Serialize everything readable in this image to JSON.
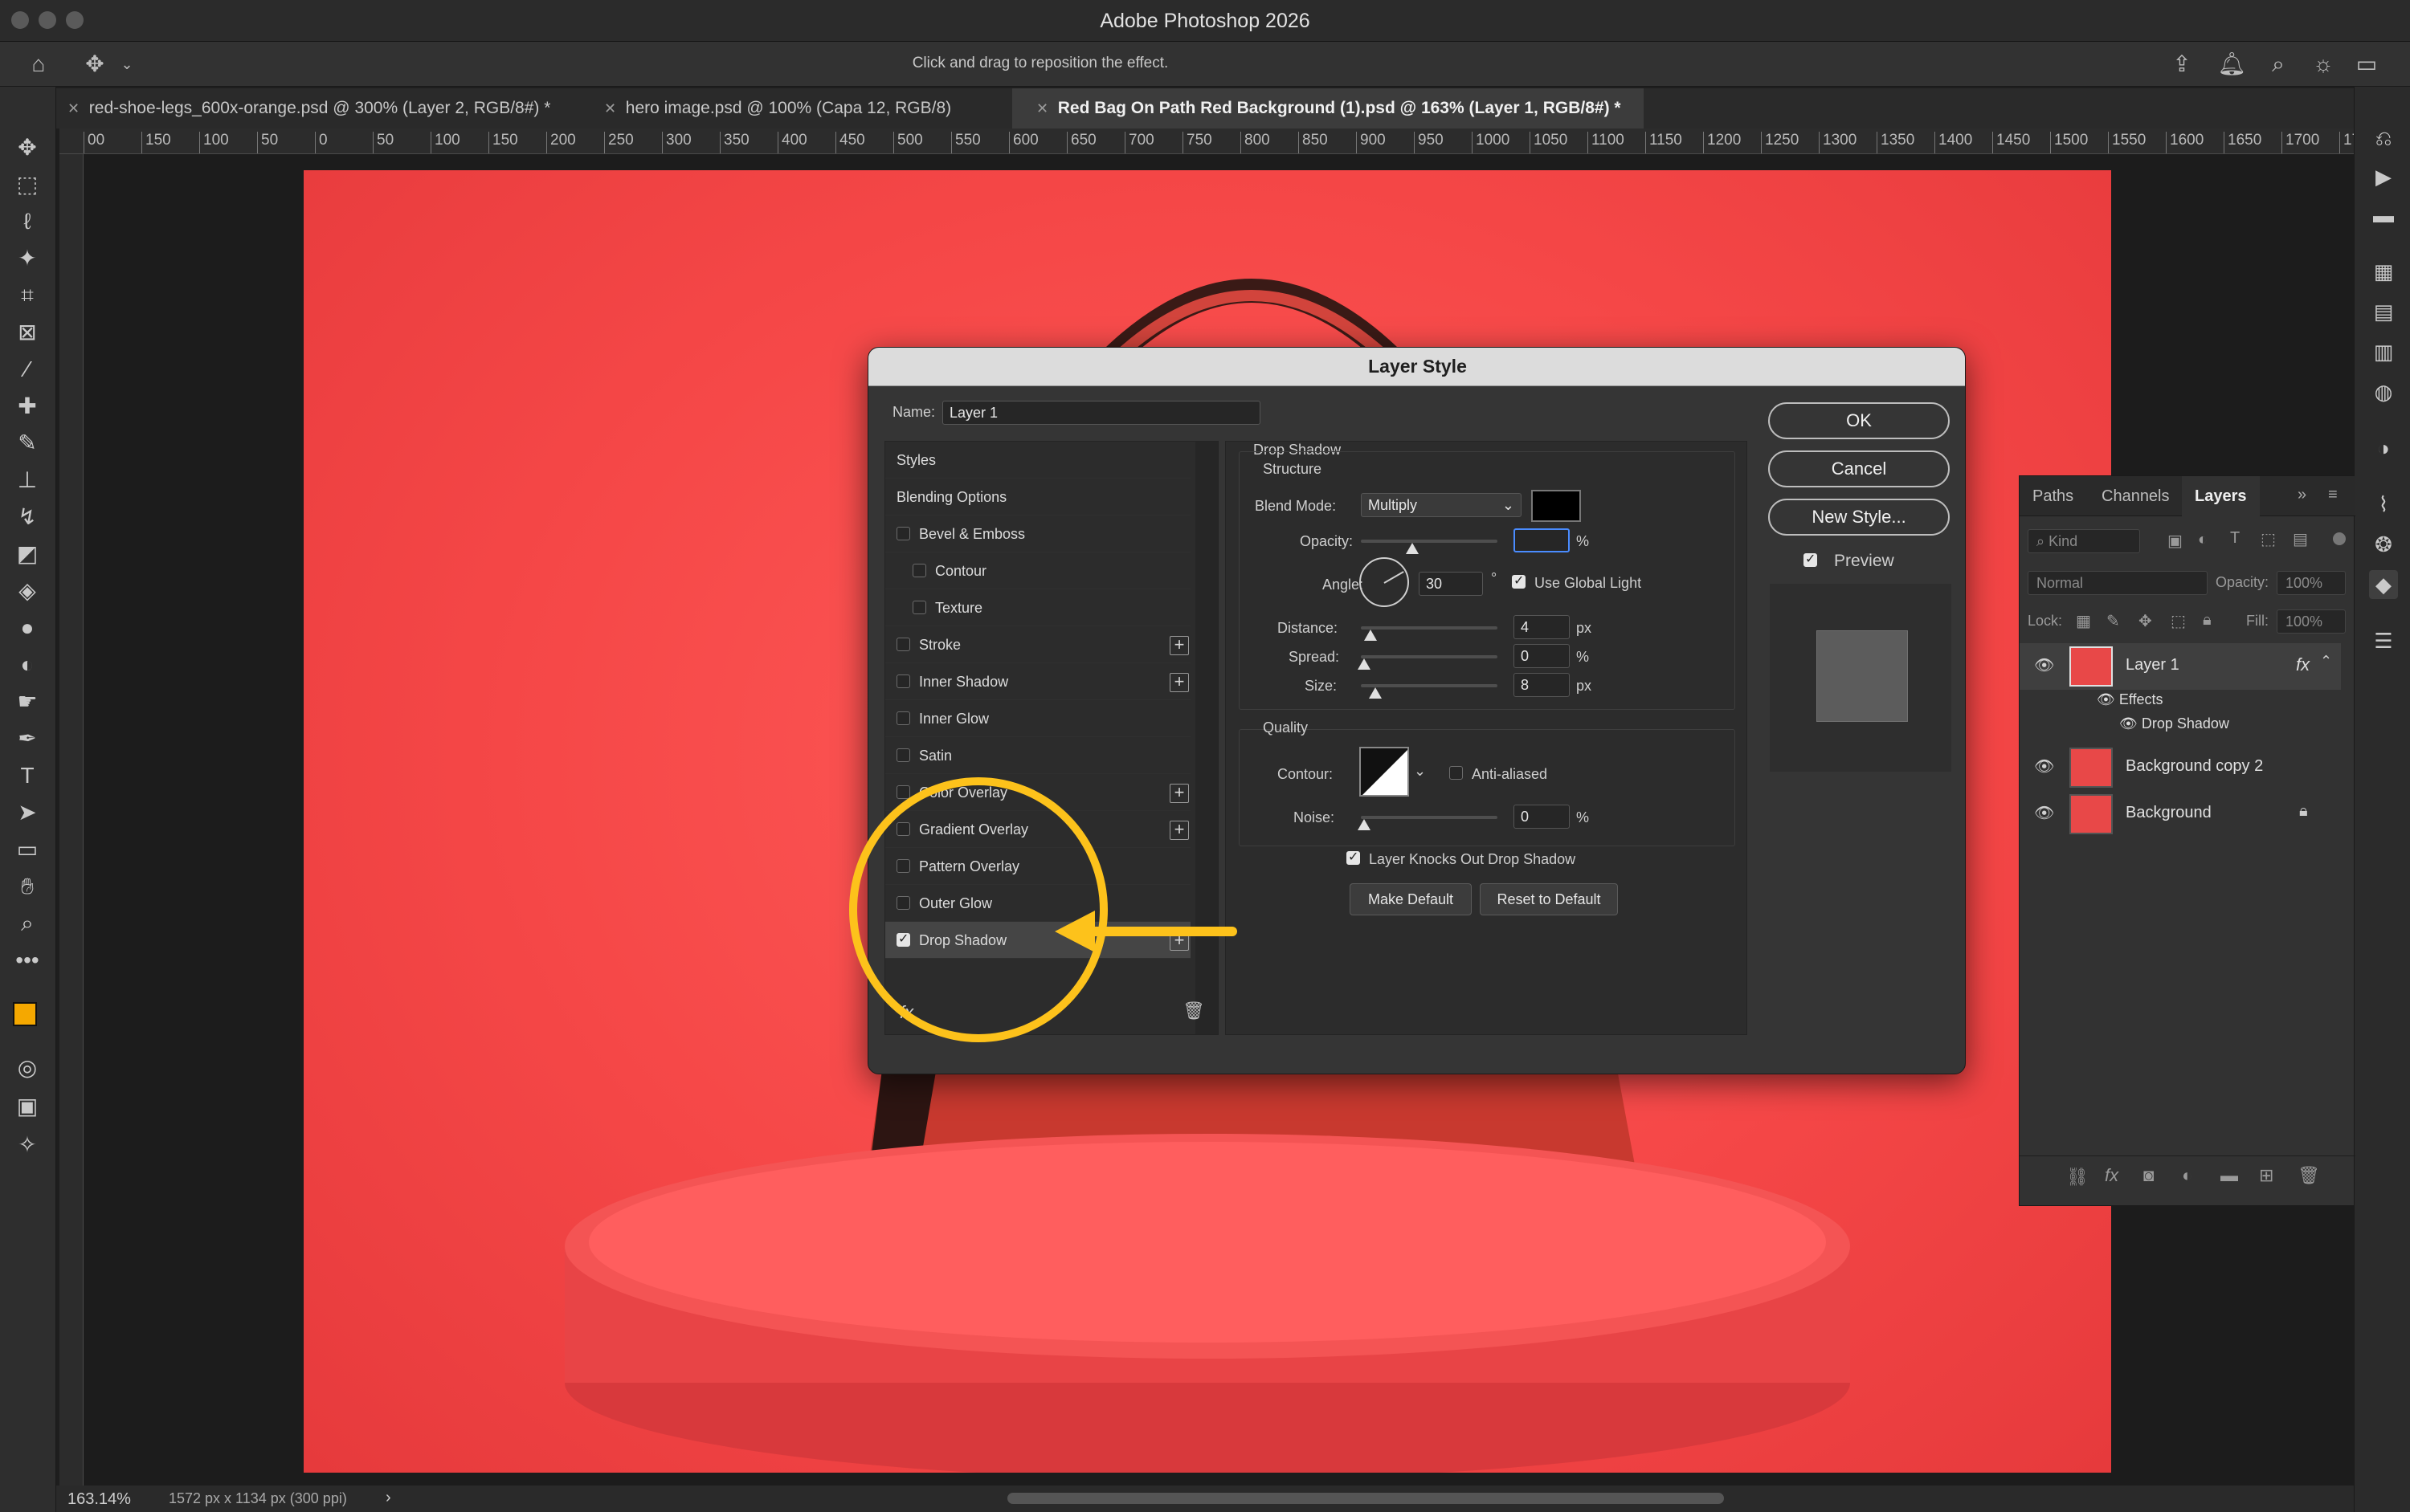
{
  "app": {
    "title": "Adobe Photoshop 2026"
  },
  "options_bar": {
    "hint": "Click and drag to reposition the effect."
  },
  "tabs": [
    {
      "label": "red-shoe-legs_600x-orange.psd @ 300% (Layer 2, RGB/8#) *"
    },
    {
      "label": "hero image.psd @ 100% (Capa 12, RGB/8)"
    },
    {
      "label": "Red Bag On Path Red Background (1).psd @ 163% (Layer 1, RGB/8#) *"
    }
  ],
  "ruler": {
    "ticks": [
      "00",
      "150",
      "100",
      "50",
      "0",
      "50",
      "100",
      "150",
      "200",
      "250",
      "300",
      "350",
      "400",
      "450",
      "500",
      "550",
      "600",
      "650",
      "700",
      "750",
      "800",
      "850",
      "900",
      "950",
      "1000",
      "1050",
      "1100",
      "1150",
      "1200",
      "1250",
      "1300",
      "1350",
      "1400",
      "1450",
      "1500",
      "1550",
      "1600",
      "1650",
      "1700",
      "17"
    ]
  },
  "status": {
    "zoom": "163.14%",
    "doc_info": "1572 px x 1134 px (300 ppi)",
    "chevron": "›"
  },
  "dialog": {
    "title": "Layer Style",
    "name_label": "Name:",
    "name_value": "Layer 1",
    "styles_header": "Styles",
    "blending_options": "Blending Options",
    "styles": [
      {
        "label": "Bevel & Emboss",
        "checked": false,
        "plus": false
      },
      {
        "label": "Contour",
        "checked": false,
        "plus": false
      },
      {
        "label": "Texture",
        "checked": false,
        "plus": false
      },
      {
        "label": "Stroke",
        "checked": false,
        "plus": true
      },
      {
        "label": "Inner Shadow",
        "checked": false,
        "plus": true
      },
      {
        "label": "Inner Glow",
        "checked": false,
        "plus": false
      },
      {
        "label": "Satin",
        "checked": false,
        "plus": false
      },
      {
        "label": "Color Overlay",
        "checked": false,
        "plus": true
      },
      {
        "label": "Gradient Overlay",
        "checked": false,
        "plus": true
      },
      {
        "label": "Pattern Overlay",
        "checked": false,
        "plus": false
      },
      {
        "label": "Outer Glow",
        "checked": false,
        "plus": false
      },
      {
        "label": "Drop Shadow",
        "checked": true,
        "plus": true
      }
    ],
    "fx_label": "fx",
    "section_title": "Drop Shadow",
    "structure_title": "Structure",
    "blend_mode_label": "Blend Mode:",
    "blend_mode_value": "Multiply",
    "shadow_color": "#000000",
    "opacity_label": "Opacity:",
    "opacity_value": "",
    "percent": "%",
    "angle_label": "Angle:",
    "angle_value": "30",
    "degree": "°",
    "use_global_light_label": "Use Global Light",
    "use_global_light": true,
    "distance_label": "Distance:",
    "distance_value": "4",
    "px": "px",
    "spread_label": "Spread:",
    "spread_value": "0",
    "size_label": "Size:",
    "size_value": "8",
    "quality_title": "Quality",
    "contour_label": "Contour:",
    "anti_aliased_label": "Anti-aliased",
    "anti_aliased": false,
    "noise_label": "Noise:",
    "noise_value": "0",
    "layer_knocks_label": "Layer Knocks Out Drop Shadow",
    "layer_knocks": true,
    "make_default_label": "Make Default",
    "reset_default_label": "Reset to Default",
    "ok_label": "OK",
    "cancel_label": "Cancel",
    "new_style_label": "New Style...",
    "preview_label": "Preview",
    "preview_checked": true
  },
  "layers_panel": {
    "tabs": [
      "Paths",
      "Channels",
      "Layers"
    ],
    "active_tab": "Layers",
    "kind_placeholder": "Kind",
    "blend_mode": "Normal",
    "opacity_label": "Opacity:",
    "opacity_value": "100%",
    "lock_label": "Lock:",
    "fill_label": "Fill:",
    "fill_value": "100%",
    "layers": [
      {
        "name": "Layer 1",
        "fx": "fx",
        "selected": true
      },
      {
        "name": "Background copy 2"
      },
      {
        "name": "Background",
        "locked": true
      }
    ],
    "effects_label": "Effects",
    "effect_item": "Drop Shadow"
  },
  "colors": {
    "accent_highlight": "#fdc21b",
    "canvas_red": "#f54747",
    "foreground_swatch": "#f5a800",
    "background_swatch": "#ffffff"
  }
}
